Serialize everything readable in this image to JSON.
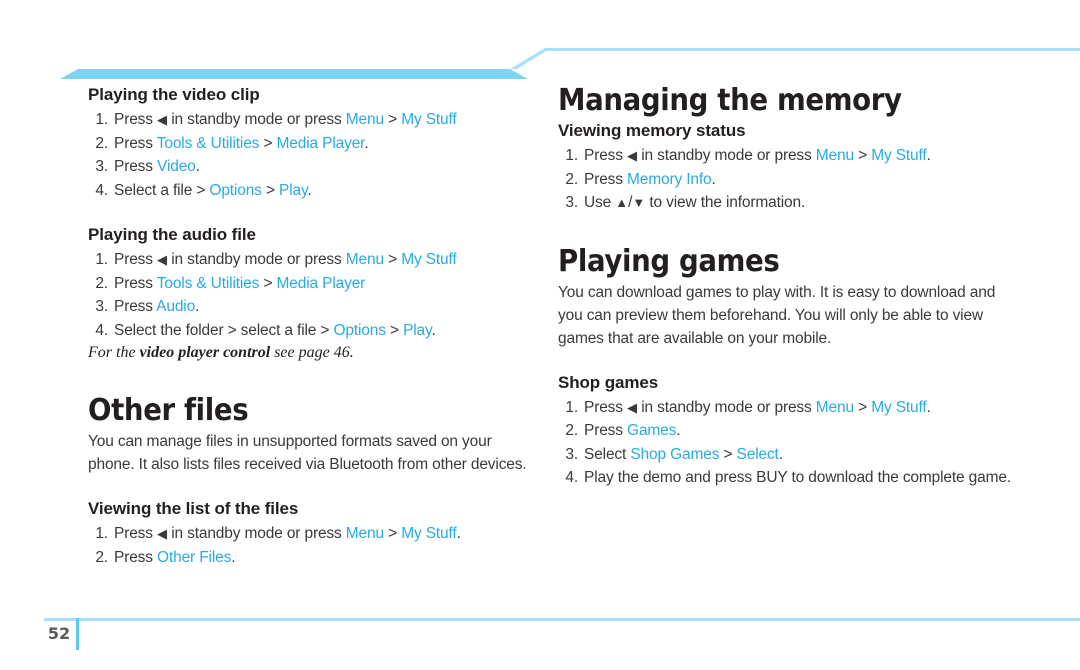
{
  "document": {
    "page_number": "52",
    "accent_color": "#29ABE2",
    "rule_color": "#a9e0f7",
    "bar_color": "#7fd4f4"
  },
  "left_column": {
    "sections": [
      {
        "heading": "Playing the video clip",
        "steps": [
          {
            "num": "1.",
            "parts": [
              {
                "t": "Press ",
                "s": "plain"
              },
              {
                "t": "◀",
                "s": "tri"
              },
              {
                "t": " in standby mode or press ",
                "s": "plain"
              },
              {
                "t": "Menu",
                "s": "link"
              },
              {
                "t": " > ",
                "s": "sep"
              },
              {
                "t": "My Stuff",
                "s": "link"
              }
            ]
          },
          {
            "num": "2.",
            "parts": [
              {
                "t": "Press ",
                "s": "plain"
              },
              {
                "t": "Tools & Utilities",
                "s": "link"
              },
              {
                "t": " > ",
                "s": "sep"
              },
              {
                "t": "Media Player",
                "s": "link"
              },
              {
                "t": ".",
                "s": "plain"
              }
            ]
          },
          {
            "num": "3.",
            "parts": [
              {
                "t": "Press ",
                "s": "plain"
              },
              {
                "t": "Video",
                "s": "link"
              },
              {
                "t": ".",
                "s": "plain"
              }
            ]
          },
          {
            "num": "4.",
            "parts": [
              {
                "t": "Select a file > ",
                "s": "plain"
              },
              {
                "t": "Options",
                "s": "link"
              },
              {
                "t": " > ",
                "s": "sep"
              },
              {
                "t": "Play",
                "s": "link"
              },
              {
                "t": ".",
                "s": "plain"
              }
            ]
          }
        ]
      },
      {
        "heading": "Playing the audio file",
        "steps": [
          {
            "num": "1.",
            "parts": [
              {
                "t": "Press ",
                "s": "plain"
              },
              {
                "t": "◀",
                "s": "tri"
              },
              {
                "t": " in standby mode or press ",
                "s": "plain"
              },
              {
                "t": "Menu",
                "s": "link"
              },
              {
                "t": " > ",
                "s": "sep"
              },
              {
                "t": "My Stuff",
                "s": "link"
              }
            ]
          },
          {
            "num": "2.",
            "parts": [
              {
                "t": "Press ",
                "s": "plain"
              },
              {
                "t": "Tools & Utilities",
                "s": "link"
              },
              {
                "t": " > ",
                "s": "sep"
              },
              {
                "t": "Media Player",
                "s": "link"
              }
            ]
          },
          {
            "num": "3.",
            "parts": [
              {
                "t": "Press ",
                "s": "plain"
              },
              {
                "t": "Audio",
                "s": "link"
              },
              {
                "t": ".",
                "s": "plain"
              }
            ]
          },
          {
            "num": "4.",
            "parts": [
              {
                "t": "Select the folder > select a file > ",
                "s": "plain"
              },
              {
                "t": "Options",
                "s": "link"
              },
              {
                "t": " > ",
                "s": "sep"
              },
              {
                "t": "Play",
                "s": "link"
              },
              {
                "t": ".",
                "s": "plain"
              }
            ]
          }
        ]
      }
    ],
    "note": {
      "prefix": "For the ",
      "bold": "video player control",
      "suffix": " see page 46."
    },
    "chapter": {
      "title": "Other files",
      "intro": "You can manage files in unsupported formats saved on your phone. It also lists files received via Bluetooth from other devices.",
      "sections": [
        {
          "heading": "Viewing the list of the files",
          "steps": [
            {
              "num": "1.",
              "parts": [
                {
                  "t": "Press ",
                  "s": "plain"
                },
                {
                  "t": "◀",
                  "s": "tri"
                },
                {
                  "t": " in standby mode or press ",
                  "s": "plain"
                },
                {
                  "t": "Menu",
                  "s": "link"
                },
                {
                  "t": " > ",
                  "s": "sep"
                },
                {
                  "t": "My Stuff",
                  "s": "link"
                },
                {
                  "t": ".",
                  "s": "plain"
                }
              ]
            },
            {
              "num": "2.",
              "parts": [
                {
                  "t": "Press ",
                  "s": "plain"
                },
                {
                  "t": "Other Files",
                  "s": "link"
                },
                {
                  "t": ".",
                  "s": "plain"
                }
              ]
            }
          ]
        }
      ]
    }
  },
  "right_column": {
    "chapter_one": {
      "title": "Managing the memory",
      "sections": [
        {
          "heading": "Viewing memory status",
          "steps": [
            {
              "num": "1.",
              "parts": [
                {
                  "t": "Press ",
                  "s": "plain"
                },
                {
                  "t": "◀",
                  "s": "tri"
                },
                {
                  "t": " in standby mode or press ",
                  "s": "plain"
                },
                {
                  "t": "Menu",
                  "s": "link"
                },
                {
                  "t": " > ",
                  "s": "sep"
                },
                {
                  "t": "My Stuff",
                  "s": "link"
                },
                {
                  "t": ".",
                  "s": "plain"
                }
              ]
            },
            {
              "num": "2.",
              "parts": [
                {
                  "t": "Press ",
                  "s": "plain"
                },
                {
                  "t": "Memory Info",
                  "s": "link"
                },
                {
                  "t": ".",
                  "s": "plain"
                }
              ]
            },
            {
              "num": "3.",
              "parts": [
                {
                  "t": "Use ",
                  "s": "plain"
                },
                {
                  "t": "▲",
                  "s": "tri"
                },
                {
                  "t": "/",
                  "s": "plain"
                },
                {
                  "t": "▼",
                  "s": "tri"
                },
                {
                  "t": " to view the information.",
                  "s": "plain"
                }
              ]
            }
          ]
        }
      ]
    },
    "chapter_two": {
      "title": "Playing games",
      "intro": "You can download games to play with. It is easy to download and you can preview them beforehand. You will only be able to view games that are available on your mobile.",
      "sections": [
        {
          "heading": "Shop games",
          "steps": [
            {
              "num": "1.",
              "parts": [
                {
                  "t": "Press ",
                  "s": "plain"
                },
                {
                  "t": "◀",
                  "s": "tri"
                },
                {
                  "t": " in standby mode or press ",
                  "s": "plain"
                },
                {
                  "t": "Menu",
                  "s": "link"
                },
                {
                  "t": " > ",
                  "s": "sep"
                },
                {
                  "t": "My Stuff",
                  "s": "link"
                },
                {
                  "t": ".",
                  "s": "plain"
                }
              ]
            },
            {
              "num": "2.",
              "parts": [
                {
                  "t": "Press ",
                  "s": "plain"
                },
                {
                  "t": "Games",
                  "s": "link"
                },
                {
                  "t": ".",
                  "s": "plain"
                }
              ]
            },
            {
              "num": "3.",
              "parts": [
                {
                  "t": "Select ",
                  "s": "plain"
                },
                {
                  "t": "Shop Games",
                  "s": "link"
                },
                {
                  "t": " > ",
                  "s": "sep"
                },
                {
                  "t": "Select",
                  "s": "link"
                },
                {
                  "t": ".",
                  "s": "plain"
                }
              ]
            },
            {
              "num": "4.",
              "parts": [
                {
                  "t": "Play the demo and press BUY to download the complete game.",
                  "s": "plain"
                }
              ]
            }
          ]
        }
      ]
    }
  }
}
